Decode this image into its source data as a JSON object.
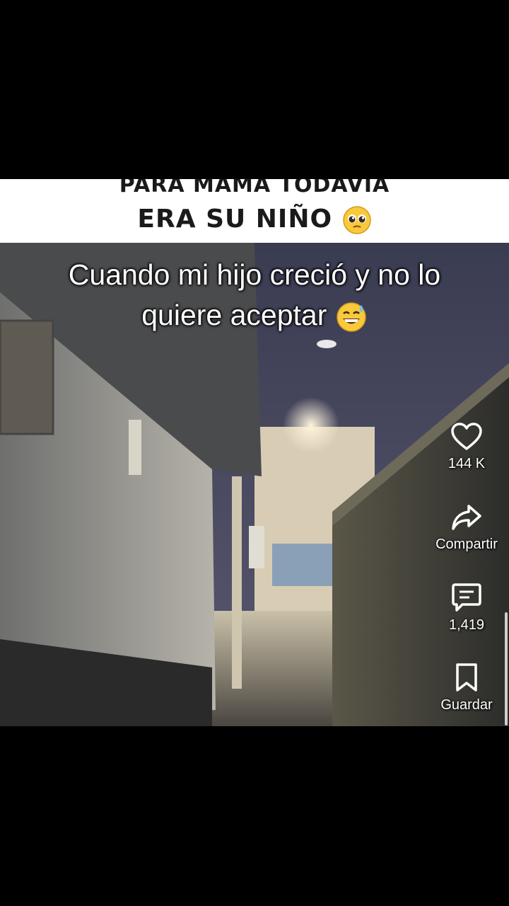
{
  "caption": {
    "line1": "PARA MAMA TODAVIA",
    "line2": "ERA SU NIÑO"
  },
  "overlay": {
    "line1": "Cuando mi hijo creció y no lo",
    "line2": "quiere aceptar"
  },
  "actions": {
    "like": {
      "icon": "heart-icon",
      "count": "144 K"
    },
    "share": {
      "icon": "share-arrow-icon",
      "label": "Compartir"
    },
    "comments": {
      "icon": "comment-icon",
      "count": "1,419"
    },
    "save": {
      "icon": "bookmark-icon",
      "label": "Guardar"
    }
  }
}
